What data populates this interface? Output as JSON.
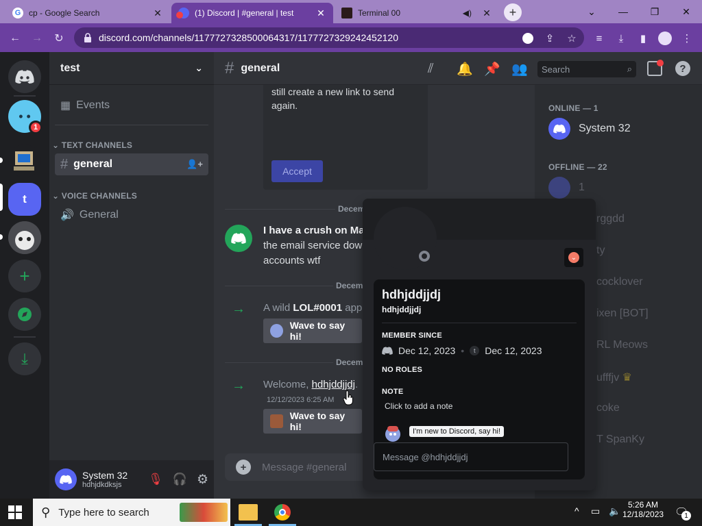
{
  "browser": {
    "tabs": [
      {
        "title": "cp - Google Search",
        "active": false
      },
      {
        "title": "(1) Discord | #general | test",
        "active": true
      },
      {
        "title": "Terminal 00",
        "active": false
      }
    ],
    "url": "discord.com/channels/1177727328500064317/1177727329242452120"
  },
  "server": {
    "name": "test",
    "badge": "1",
    "icon_letter": "t"
  },
  "channels": {
    "events_label": "Events",
    "text_category": "TEXT CHANNELS",
    "text_channel": "general",
    "voice_category": "VOICE CHANNELS",
    "voice_channel": "General"
  },
  "user": {
    "name": "System 32",
    "tag": "hdhjdkdksjs"
  },
  "chat": {
    "channel_name": "general",
    "search_placeholder": "Search",
    "invite_text_1": "still create a new link to send",
    "invite_text_2": "again.",
    "accept_label": "Accept",
    "date_1": "Decem",
    "msg_bold": "I have a crush on Mat",
    "msg_line2": "the email service dow",
    "msg_line3": "accounts wtf",
    "date_2": "Decemb",
    "join_prefix": "A wild",
    "join_user": "LOL#0001",
    "join_suffix": "app",
    "wave_label": "Wave to say hi!",
    "date_3": "Decemb",
    "welcome_prefix": "Welcome,",
    "welcome_user": "hdhjddjjdj",
    "welcome_time": "12/12/2023 6:25 AM",
    "composer_placeholder": "Message #general"
  },
  "members": {
    "online_header": "ONLINE — 1",
    "online": [
      "System 32"
    ],
    "offline_header": "OFFLINE — 22",
    "offline_partial": [
      "1",
      "rggdd",
      "ty",
      "cocklover",
      "ixen [BOT]",
      "RL Meows",
      "ufffjv",
      "coke",
      "T SpanKy"
    ]
  },
  "popout": {
    "display_name": "hdhjddjjdj",
    "username": "hdhjddjjdj",
    "member_since_label": "MEMBER SINCE",
    "discord_since": "Dec 12, 2023",
    "server_since": "Dec 12, 2023",
    "server_initial": "t",
    "roles_label": "NO ROLES",
    "note_label": "NOTE",
    "note_placeholder": "Click to add a note",
    "sticker_caption": "I'm new to Discord, say hi!",
    "message_placeholder": "Message @hdhjddjjdj"
  },
  "taskbar": {
    "search_placeholder": "Type here to search",
    "time": "5:26 AM",
    "date": "12/18/2023",
    "notif_count": "1"
  },
  "colors": {
    "blurple": "#5865f2",
    "green": "#23a55a",
    "red": "#f23f43",
    "browser_purple": "#6b3fa0"
  }
}
